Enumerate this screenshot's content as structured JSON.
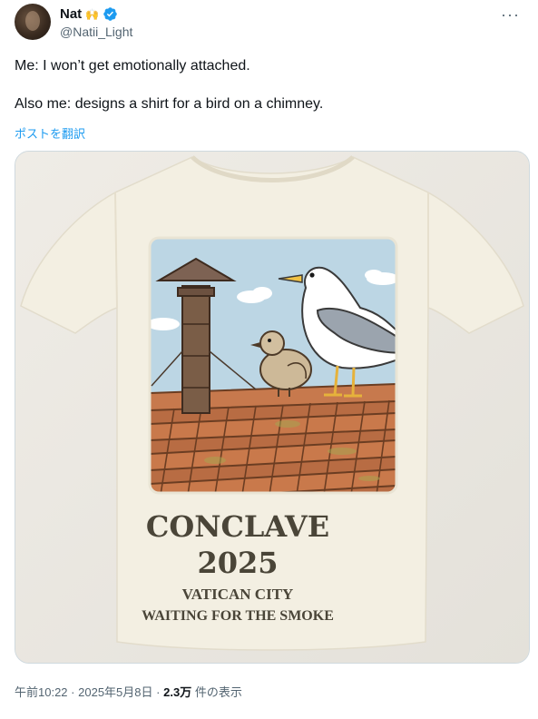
{
  "author": {
    "display_name": "Nat",
    "handle": "@Natii_Light",
    "verified": true,
    "badge_icon": "raised-hands-emoji",
    "more_icon": "more-horizontal-icon"
  },
  "tweet": {
    "line1": "Me: I won’t get emotionally attached.",
    "line2": "Also me: designs a shirt for a bird on a chimney.",
    "translate_label": "ポストを翻訳"
  },
  "shirt_print": {
    "title": "CONCLAVE",
    "year": "2025",
    "line1": "VATICAN CITY",
    "line2": "WAITING FOR THE SMOKE"
  },
  "meta": {
    "time": "午前10:22",
    "date": "2025年5月8日",
    "views_count": "2.3万",
    "views_label": "件の表示",
    "sep": "·"
  },
  "colors": {
    "link": "#1d9bf0",
    "verified": "#1d9bf0",
    "secondary_text": "#536471",
    "shirt": "#f3efe2",
    "sky": "#b9d4e3",
    "tile": "#c9784a"
  }
}
